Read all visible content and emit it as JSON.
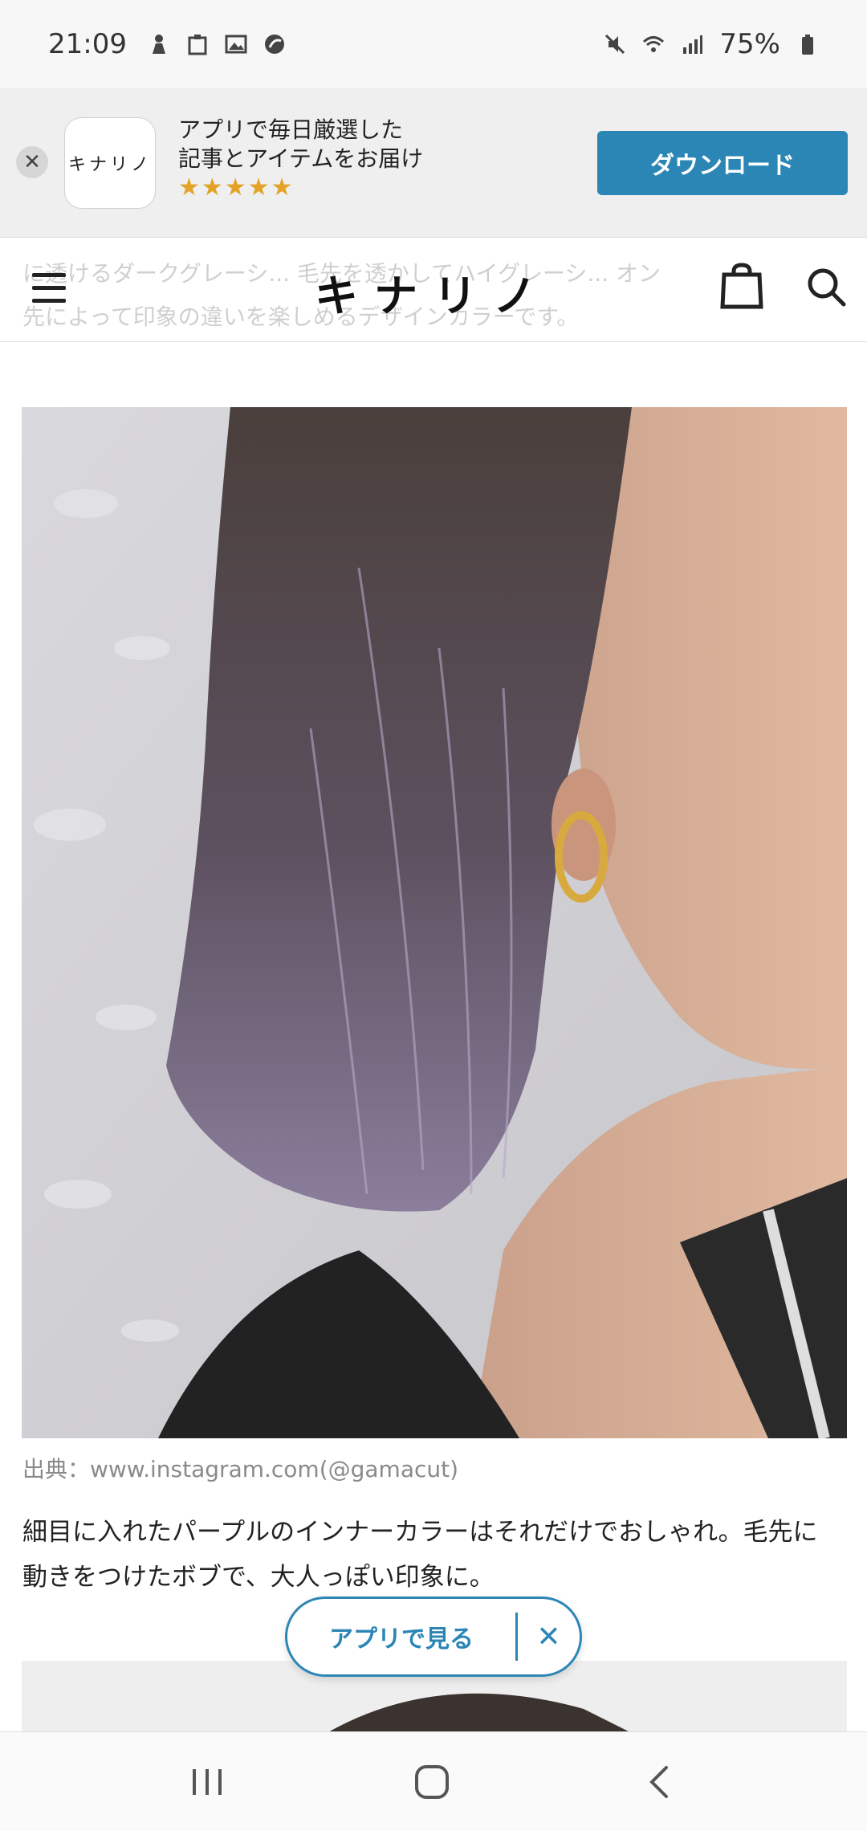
{
  "status_bar": {
    "time": "21:09",
    "battery": "75%",
    "icons": [
      "person-icon",
      "clipboard-icon",
      "image-icon",
      "pie-icon",
      "mute-icon",
      "wifi-icon",
      "signal-icon",
      "battery-icon"
    ]
  },
  "app_banner": {
    "logo_text": "キナリノ",
    "line1": "アプリで毎日厳選した",
    "line2": "記事とアイテムをお届け",
    "stars": "★★★★★",
    "download_label": "ダウンロード",
    "close_label": "✕"
  },
  "header": {
    "logo": "キナリノ",
    "ghost_line1": "に透けるダークグレーシ... 毛先を透かしてハイグレーシ... オン",
    "ghost_line2": "先によって印象の違いを楽しめるデザインカラーです。"
  },
  "article": {
    "image_source": "出典：www.instagram.com(@gamacut)",
    "body_line1": "細目に入れたパープルのインナーカラーはそれだけでおしゃれ。毛先に",
    "body_line2": "動きをつけたボブで、大人っぽい印象に。"
  },
  "app_pill": {
    "label": "アプリで見る",
    "close": "✕"
  },
  "colors": {
    "accent": "#2b86b6",
    "star": "#e3a326",
    "banner_bg": "#efefef"
  }
}
